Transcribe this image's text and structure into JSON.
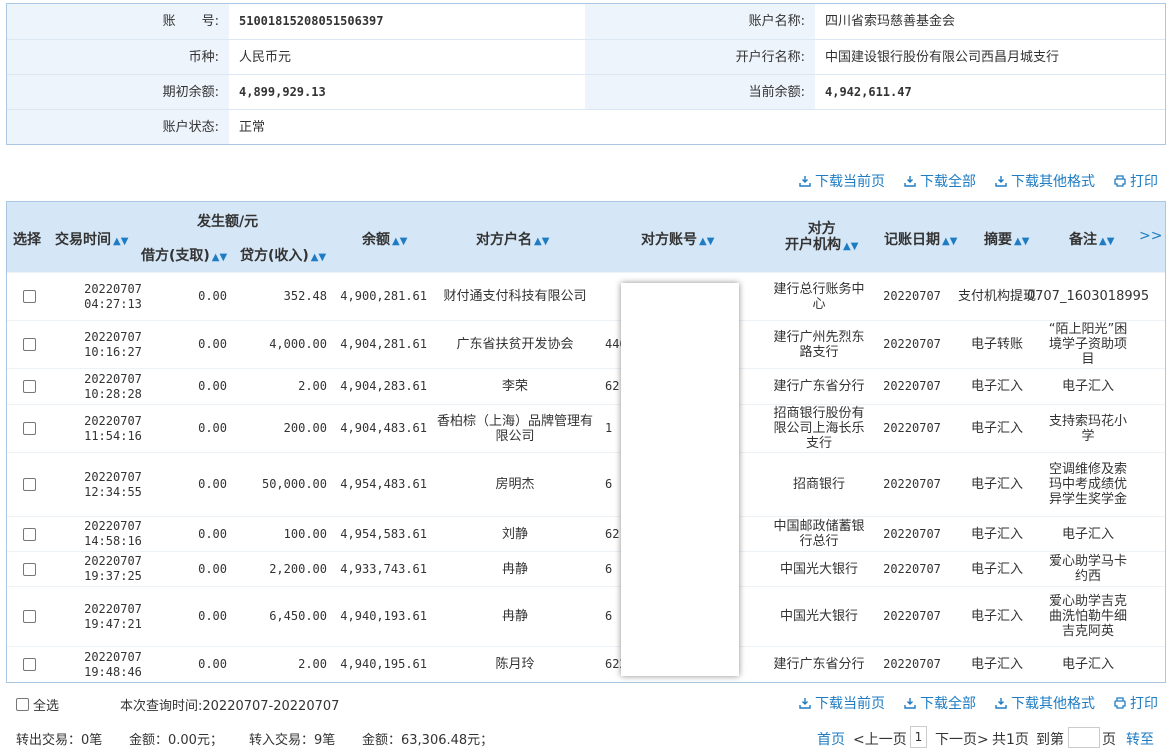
{
  "account": {
    "no_label": "账　　号:",
    "no_value": "51001815208051506397",
    "name_label": "账户名称:",
    "name_value": "四川省索玛慈善基金会",
    "currency_label": "币种:",
    "currency_value": "人民币元",
    "bank_label": "开户行名称:",
    "bank_value": "中国建设银行股份有限公司西昌月城支行",
    "opening_label": "期初余额:",
    "opening_value": "4,899,929.13",
    "current_label": "当前余额:",
    "current_value": "4,942,611.47",
    "status_label": "账户状态:",
    "status_value": "正常"
  },
  "toolbar": {
    "download_page": "下载当前页",
    "download_all": "下载全部",
    "download_other": "下载其他格式",
    "print": "打印"
  },
  "headers": {
    "select": "选择",
    "time": "交易时间",
    "amount_group": "发生额/元",
    "debit": "借方(支取)",
    "credit": "贷方(收入)",
    "balance": "余额",
    "counterparty": "对方户名",
    "account": "对方账号",
    "bank_line1": "对方",
    "bank_line2": "开户机构",
    "date": "记账日期",
    "summary": "摘要",
    "remark": "备注",
    "more": ">>"
  },
  "rows": [
    {
      "date1": "20220707",
      "time": "04:27:13",
      "debit": "0.00",
      "credit": "352.48",
      "balance": "4,900,281.61",
      "name": "财付通支付科技有限公司",
      "acct": "",
      "bank": "建行总行账务中心",
      "post": "20220707",
      "summary": "支付机构提现",
      "remark": "0707_1603018995"
    },
    {
      "date1": "20220707",
      "time": "10:16:27",
      "debit": "0.00",
      "credit": "4,000.00",
      "balance": "4,904,281.61",
      "name": "广东省扶贫开发协会",
      "acct": "440",
      "bank": "建行广州先烈东路支行",
      "post": "20220707",
      "summary": "电子转账",
      "remark": "“陌上阳光”困境学子资助项目"
    },
    {
      "date1": "20220707",
      "time": "10:28:28",
      "debit": "0.00",
      "credit": "2.00",
      "balance": "4,904,283.61",
      "name": "李荣",
      "acct": "621",
      "bank": "建行广东省分行",
      "post": "20220707",
      "summary": "电子汇入",
      "remark": "电子汇入"
    },
    {
      "date1": "20220707",
      "time": "11:54:16",
      "debit": "0.00",
      "credit": "200.00",
      "balance": "4,904,483.61",
      "name": "香柏棕（上海）品牌管理有限公司",
      "acct": "1",
      "bank": "招商银行股份有限公司上海长乐支行",
      "post": "20220707",
      "summary": "电子汇入",
      "remark": "支持索玛花小学"
    },
    {
      "date1": "20220707",
      "time": "12:34:55",
      "debit": "0.00",
      "credit": "50,000.00",
      "balance": "4,954,483.61",
      "name": "房明杰",
      "acct": "6",
      "bank": "招商银行",
      "post": "20220707",
      "summary": "电子汇入",
      "remark": "空调维修及索玛中考成绩优异学生奖学金"
    },
    {
      "date1": "20220707",
      "time": "14:58:16",
      "debit": "0.00",
      "credit": "100.00",
      "balance": "4,954,583.61",
      "name": "刘静",
      "acct": "621",
      "bank": "中国邮政储蓄银行总行",
      "post": "20220707",
      "summary": "电子汇入",
      "remark": "电子汇入"
    },
    {
      "date1": "20220707",
      "time": "19:37:25",
      "debit": "0.00",
      "credit": "2,200.00",
      "balance": "4,933,743.61",
      "name": "冉静",
      "acct": "6",
      "bank": "中国光大银行",
      "post": "20220707",
      "summary": "电子汇入",
      "remark": "爱心助学马卡约西"
    },
    {
      "date1": "20220707",
      "time": "19:47:21",
      "debit": "0.00",
      "credit": "6,450.00",
      "balance": "4,940,193.61",
      "name": "冉静",
      "acct": "6",
      "bank": "中国光大银行",
      "post": "20220707",
      "summary": "电子汇入",
      "remark": "爱心助学吉克曲洗怕勒牛细吉克阿英"
    },
    {
      "date1": "20220707",
      "time": "19:48:46",
      "debit": "0.00",
      "credit": "2.00",
      "balance": "4,940,195.61",
      "name": "陈月玲",
      "acct": "622",
      "bank": "建行广东省分行",
      "post": "20220707",
      "summary": "电子汇入",
      "remark": "电子汇入"
    }
  ],
  "footer": {
    "select_all": "全选",
    "query_time": "本次查询时间:20220707-20220707",
    "out_trans": "转出交易：0笔",
    "out_amount": "金额：0.00元；",
    "in_trans": "转入交易：9笔",
    "in_amount": "金额：63,306.48元；",
    "first": "首页",
    "prev": "<上一页",
    "page": "1",
    "next": "下一页>",
    "total": "共1页",
    "goto_label": "到第",
    "page_unit": "页",
    "go": "转至"
  },
  "colors": {
    "accent": "#1e7cc3",
    "header_bg": "#d5e6f6",
    "label_bg": "#eef4fb",
    "border": "#a9c7e0"
  }
}
